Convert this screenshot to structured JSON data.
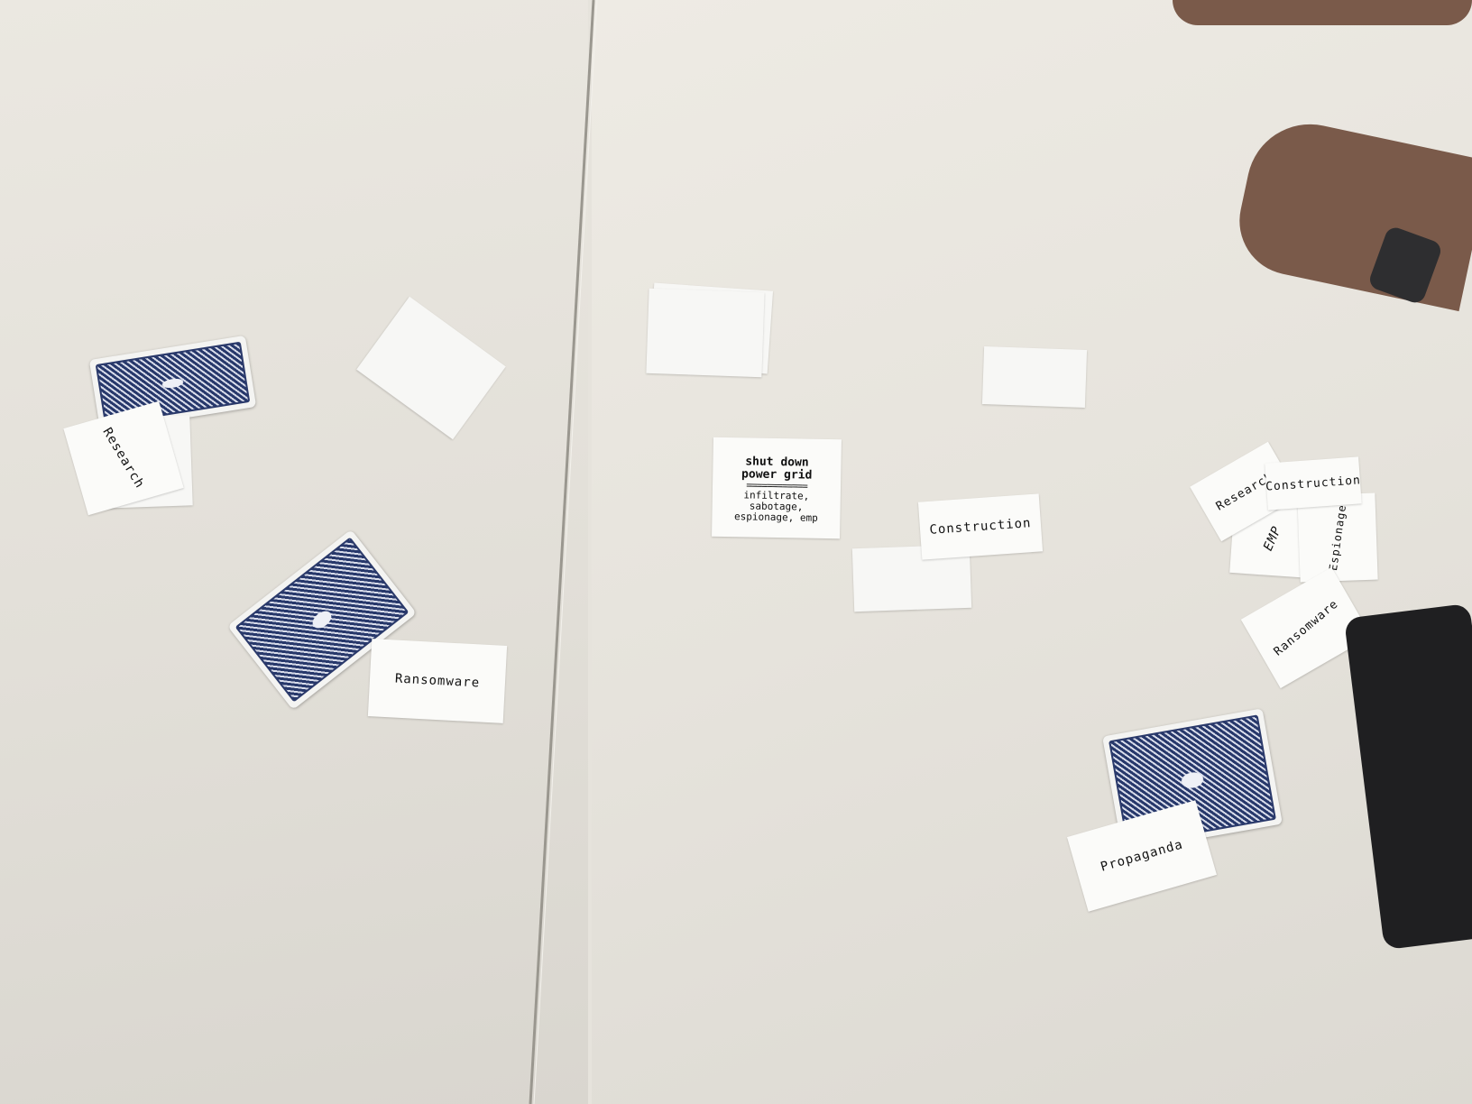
{
  "colors": {
    "table": "#e6e3dc",
    "card_white": "#fbfbf9",
    "card_back_blue": "#27386b",
    "skin": "#7a5a4a",
    "device": "#1f1f21"
  },
  "cards": {
    "research_left": "Research",
    "ransomware_left": "Ransomware",
    "construction_center": "Construction",
    "research_right": "Research",
    "construction_right": "Construction",
    "emp_right": "EMP",
    "espionage_right": "Espionage",
    "ransomware_right": "Ransomware",
    "propaganda": "Propaganda"
  },
  "goal_card": {
    "title_line1": "shut down",
    "title_line2": "power grid",
    "rule": "============",
    "actions_line1": "infiltrate,",
    "actions_line2": "sabotage,",
    "actions_line3": "espionage, emp"
  }
}
